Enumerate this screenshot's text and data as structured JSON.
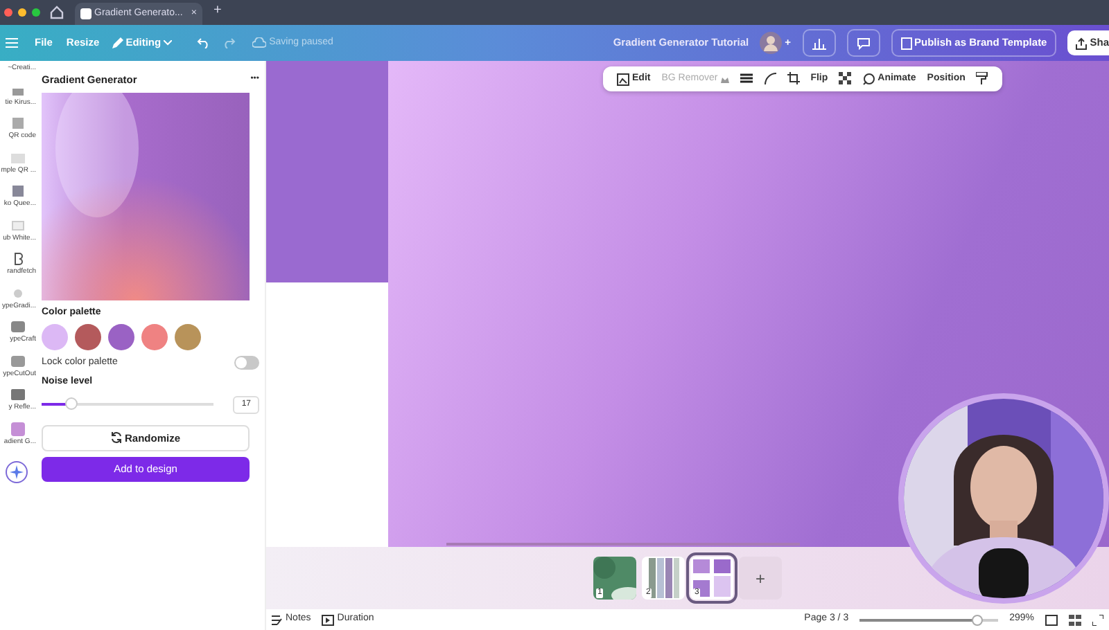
{
  "browser": {
    "tab_title": "Gradient Generato...",
    "tab_close": "×",
    "new_tab": "+"
  },
  "menu_bar": {
    "items": [
      {
        "kind": "menu",
        "label": "File"
      },
      {
        "kind": "resize",
        "label": "Resize"
      },
      {
        "kind": "editing",
        "label": "Editing"
      }
    ],
    "save_status": "Saving paused",
    "design_title": "Gradient Generator Tutorial",
    "add_people": "+",
    "publish": "Publish as Brand Template",
    "share": "Sha"
  },
  "context_toolbar": {
    "items": [
      {
        "kind": "edit",
        "label": "Edit"
      },
      {
        "kind": "disabled",
        "label": "BG Remover"
      },
      {
        "kind": "lines"
      },
      {
        "kind": "corner"
      },
      {
        "kind": "crop"
      },
      {
        "kind": "text",
        "label": "Flip"
      },
      {
        "kind": "transparency"
      },
      {
        "kind": "animate",
        "label": "Animate"
      },
      {
        "kind": "text",
        "label": "Position"
      },
      {
        "kind": "paint"
      }
    ]
  },
  "apps_rail": {
    "items": [
      {
        "label": "~Creati..."
      },
      {
        "label": "tie Kirus..."
      },
      {
        "label": "QR code"
      },
      {
        "label": "mple QR ..."
      },
      {
        "label": "ko Quee..."
      },
      {
        "label": "ub White..."
      },
      {
        "label": "randfetch"
      },
      {
        "label": "ypeGradi..."
      },
      {
        "label": "ypeCraft"
      },
      {
        "label": "ypeCutOut"
      },
      {
        "label": "y Refle..."
      },
      {
        "label": "adient G..."
      }
    ]
  },
  "panel": {
    "title": "Gradient Generator",
    "more": "•••",
    "palette_label": "Color palette",
    "palette": [
      {
        "color": "#dcb8f5"
      },
      {
        "color": "#b45a5c"
      },
      {
        "color": "#9a62c4"
      },
      {
        "color": "#ef8282"
      },
      {
        "color": "#b8935a"
      }
    ],
    "lock_label": "Lock color palette",
    "lock_on": false,
    "noise_label": "Noise level",
    "noise": {
      "level": 0.17,
      "reading": "17"
    },
    "randomize": "Randomize",
    "add": "Add to design"
  },
  "pages": {
    "items": [
      {
        "number": "1",
        "selected": false,
        "kind": "green"
      },
      {
        "number": "2",
        "selected": false,
        "kind": "collage"
      },
      {
        "number": "3",
        "selected": true,
        "kind": "purple"
      }
    ],
    "add": "+"
  },
  "status_bar": {
    "notes": "Notes",
    "duration": "Duration",
    "page": "Page 3 / 3",
    "zoom": {
      "level": 0.85,
      "reading": "299%"
    }
  }
}
